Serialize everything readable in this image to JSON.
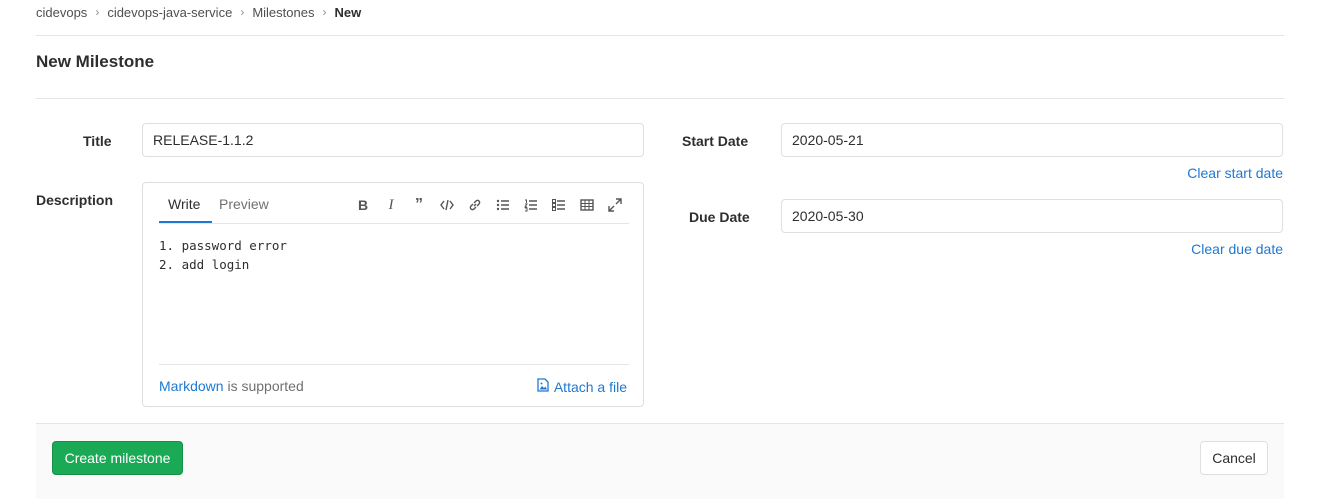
{
  "breadcrumb": {
    "items": [
      "cidevops",
      "cidevops-java-service",
      "Milestones"
    ],
    "current": "New"
  },
  "page_title": "New Milestone",
  "form": {
    "title_label": "Title",
    "title_value": "RELEASE-1.1.2",
    "description_label": "Description",
    "start_date_label": "Start Date",
    "start_date_value": "2020-05-21",
    "clear_start_label": "Clear start date",
    "due_date_label": "Due Date",
    "due_date_value": "2020-05-30",
    "clear_due_label": "Clear due date"
  },
  "editor": {
    "tabs": [
      "Write",
      "Preview"
    ],
    "content": "1. password error\n2. add login",
    "help_link": "Markdown",
    "help_suffix": " is supported",
    "attach_label": "Attach a file",
    "toolbar_icons": [
      "bold-icon",
      "italic-icon",
      "quote-icon",
      "code-icon",
      "link-icon",
      "bullet-list-icon",
      "numbered-list-icon",
      "task-list-icon",
      "table-icon",
      "fullscreen-icon"
    ]
  },
  "actions": {
    "create_label": "Create milestone",
    "cancel_label": "Cancel"
  },
  "colors": {
    "accent": "#1f78d1",
    "success": "#1aaa55"
  }
}
